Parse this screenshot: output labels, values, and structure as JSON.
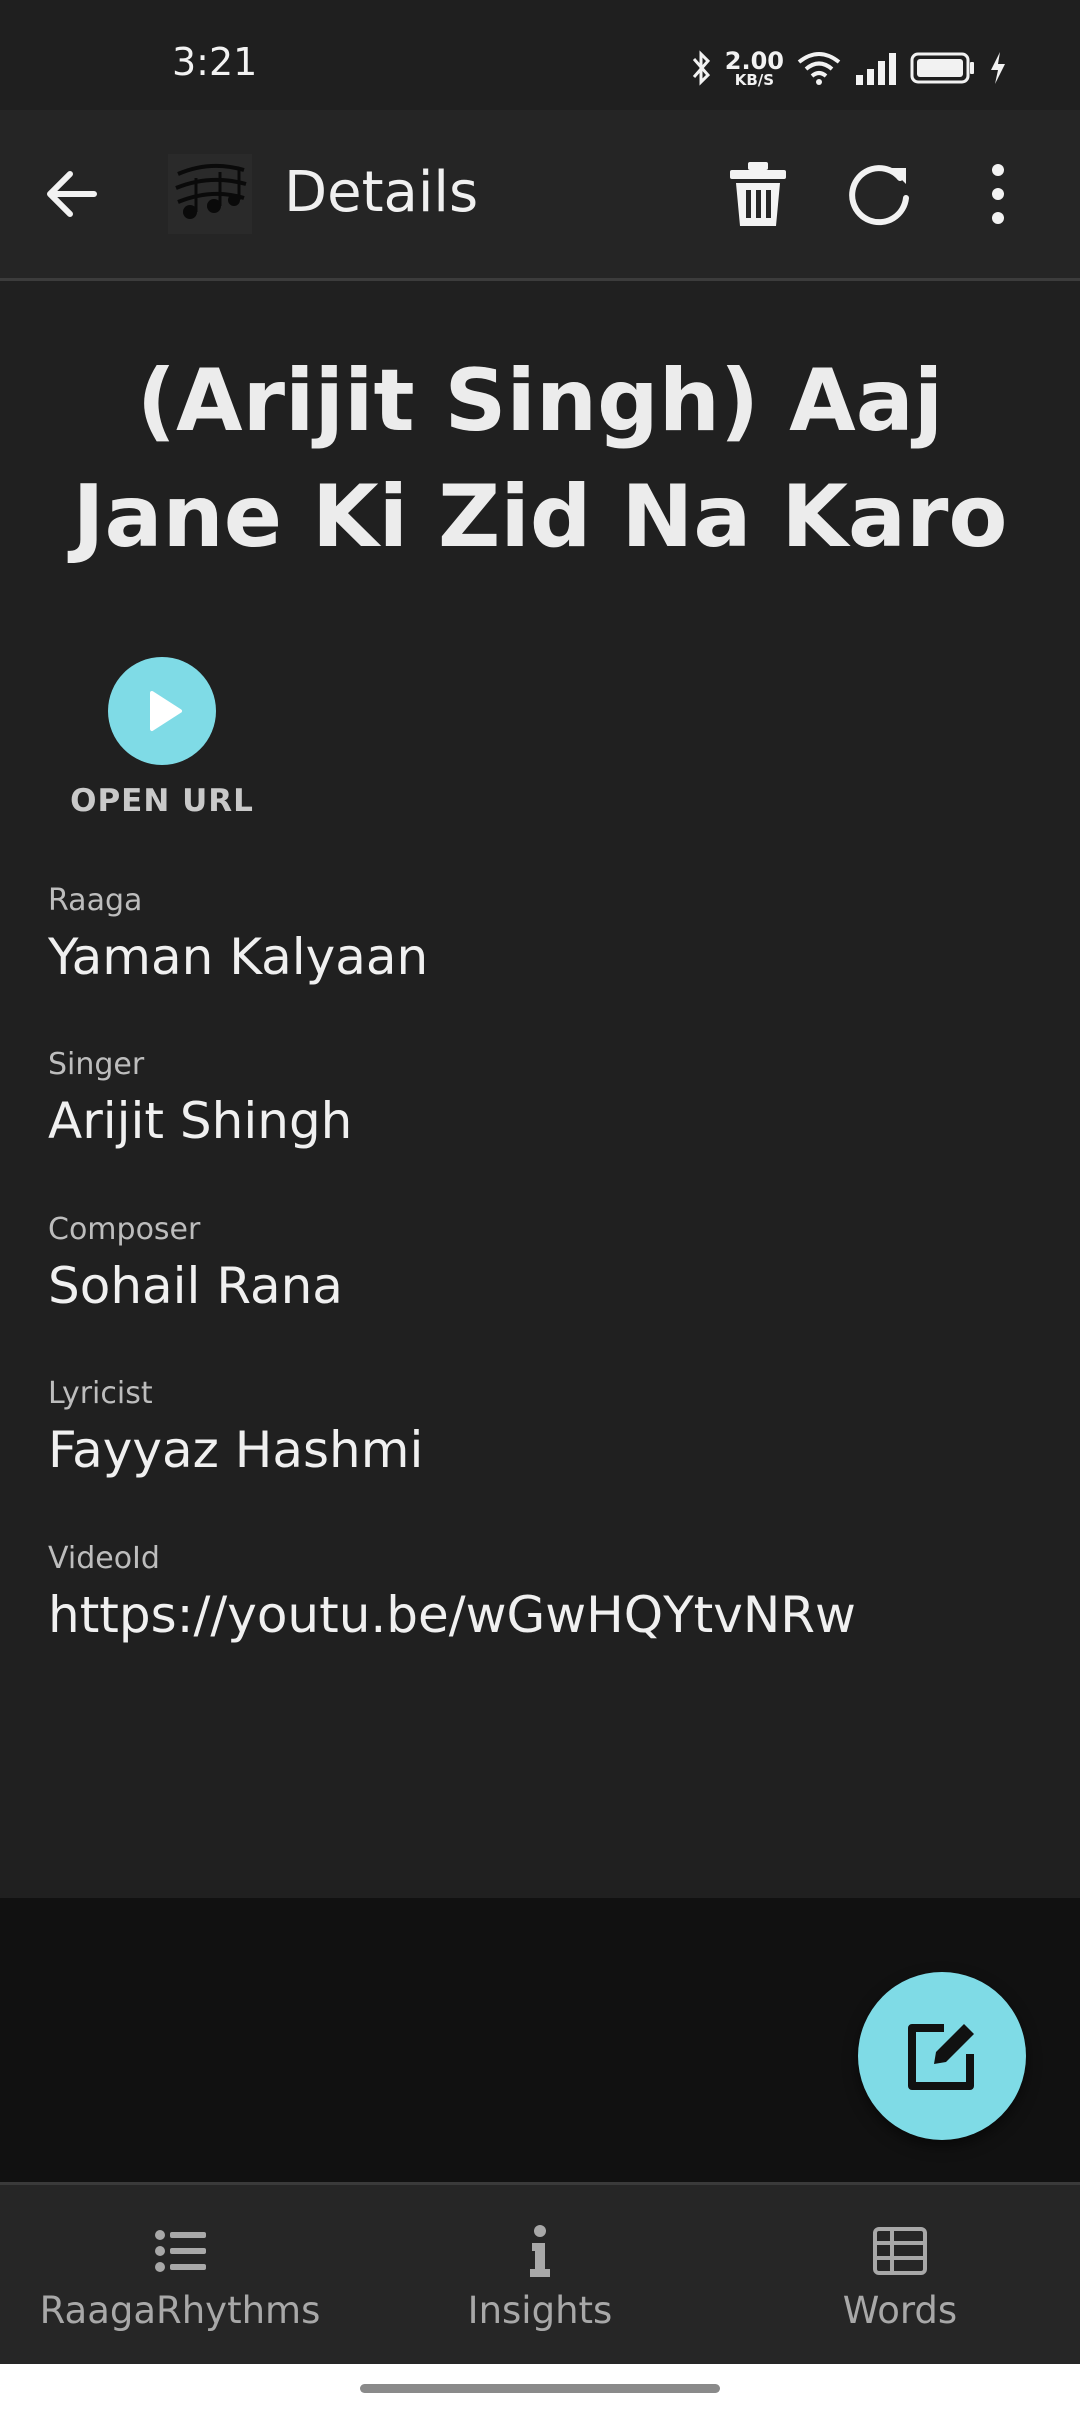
{
  "status_bar": {
    "time": "3:21",
    "net_speed_value": "2.00",
    "net_speed_unit": "KB/S",
    "icons": [
      "bluetooth-icon",
      "wifi-icon",
      "signal-icon",
      "battery-icon",
      "charging-icon"
    ]
  },
  "app_bar": {
    "title": "Details",
    "actions": [
      "delete-icon",
      "refresh-icon",
      "more-vert-icon"
    ]
  },
  "song": {
    "title": "(Arijit Singh) Aaj Jane Ki Zid Na Karo",
    "open_url_label": "OPEN URL"
  },
  "fields": [
    {
      "label": "Raaga",
      "value": "Yaman Kalyaan"
    },
    {
      "label": "Singer",
      "value": "Arijit Shingh"
    },
    {
      "label": "Composer",
      "value": "Sohail Rana"
    },
    {
      "label": "Lyricist",
      "value": "Fayyaz Hashmi"
    },
    {
      "label": "VideoId",
      "value": "https://youtu.be/wGwHQYtvNRw"
    }
  ],
  "bottom_nav": [
    {
      "label": "RaagaRhythms",
      "icon": "list-icon"
    },
    {
      "label": "Insights",
      "icon": "info-icon"
    },
    {
      "label": "Words",
      "icon": "table-icon"
    }
  ],
  "colors": {
    "accent": "#7fdbe6",
    "background": "#202020",
    "app_bar": "#252525"
  }
}
